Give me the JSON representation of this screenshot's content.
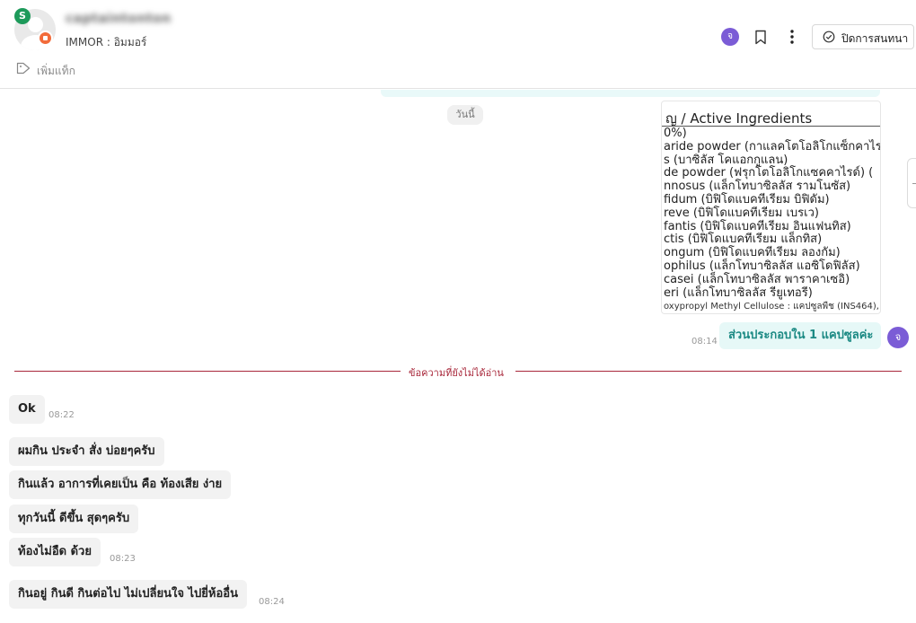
{
  "header": {
    "username": "captaintonton",
    "brand_badge": "S",
    "store_name": "IMMOR : อิมมอร์",
    "agent_initial": "จ",
    "close_chat_label": "ปิดการสนทนา",
    "add_tag_label": "เพิ่มแท็ก"
  },
  "chat": {
    "date_label": "วันนี้",
    "image_message": {
      "title": "ญ / Active Ingredients",
      "lines": [
        "0%)",
        "aride powder (กาแลคโตโอลิโกแซ็กคาไรด์",
        "s (บาซิลัส โคแอกกูแลน)",
        "de powder (ฟรุกโตโอลิโกแซคคาไรด์) (",
        "nnosus (แล็กโทบาซิลลัส รามโนซัส)",
        "fidum (บิฟิโดแบคทีเรียม บิฟิดัม)",
        "reve (บิฟิโดแบคทีเรียม เบรเว)",
        "fantis (บิฟิโดแบคทีเรียม อินแฟนทิส)",
        "ctis (บิฟิโดแบคทีเรียม แล็กทิส)",
        "ongum (บิฟิโดแบคทีเรียม ลองกัม)",
        "ophilus (แล็กโทบาซิลลัส แอซิโดฟิลัส)",
        "casei (แล็กโทบาซิลลัส พาราคาเซอิ)",
        "eri (แล็กโทบาซิลลัส รียูเทอรี)",
        "oxypropyl Methyl Cellulose : แคปซูลพืช (INS464), "
      ]
    },
    "outgoing": {
      "text": "ส่วนประกอบใน 1 แคปซูลค่ะ",
      "time": "08:14",
      "avatar_initial": "จ"
    },
    "unread_label": "ข้อความที่ยังไม่ได้อ่าน",
    "incoming": [
      {
        "text": "Ok",
        "time": "08:22"
      },
      {
        "text": "ผมกิน ประจำ สั่ง บ่อยๆครับ",
        "time": ""
      },
      {
        "text": "กินแล้ว อาการที่เคยเป็น คือ ท้องเสีย ง่าย",
        "time": ""
      },
      {
        "text": "ทุกวันนี้ ดีขึ้น สุดๆครับ",
        "time": ""
      },
      {
        "text": "ท้องไม่อืด ด้วย",
        "time": "08:23"
      },
      {
        "text": "กินอยู่ กินดี กินต่อไป ไม่เปลี่ยนใจ ไปยี่ห้ออื่น",
        "time": "08:24"
      }
    ]
  }
}
